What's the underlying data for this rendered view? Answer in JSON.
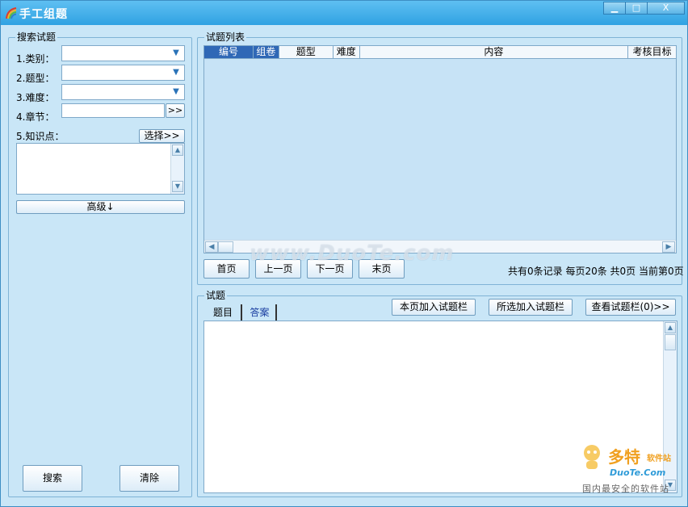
{
  "window": {
    "title": "手工组题",
    "minimize_glyph": "▁",
    "maximize_glyph": "□",
    "close_glyph": "X"
  },
  "search": {
    "group_title": "搜索试题",
    "category_label": "1.类别：",
    "category_value": "",
    "type_label": "2.题型：",
    "type_value": "",
    "difficulty_label": "3.难度：",
    "difficulty_value": "",
    "chapter_label": "4.章节：",
    "chapter_value": "",
    "chapter_button": ">>",
    "knowledge_label": "5.知识点：",
    "select_button": "选择>>",
    "knowledge_value": "",
    "advanced_button": "高级↓",
    "search_button": "搜索",
    "clear_button": "清除"
  },
  "question_list": {
    "group_title": "试题列表",
    "columns": [
      "编号",
      "组卷",
      "题型",
      "难度",
      "内容",
      "考核目标"
    ],
    "selected_columns": [
      "编号",
      "组卷"
    ],
    "rows": [],
    "first_page": "首页",
    "prev_page": "上一页",
    "next_page": "下一页",
    "last_page": "末页",
    "status": "共有0条记录 每页20条 共0页 当前第0页"
  },
  "question": {
    "group_title": "试题",
    "tabs": [
      "题目",
      "答案"
    ],
    "active_tab": "题目",
    "add_page_button": "本页加入试题栏",
    "add_selected_button": "所选加入试题栏",
    "view_basket_button": "查看试题栏(0)>>",
    "body": ""
  },
  "watermark": {
    "text": "www.DuoTe.com",
    "brand": "多特",
    "brand_sub": "软件站",
    "url": "DuoTe.Com",
    "tagline": "国内最安全的软件站"
  },
  "colors": {
    "titlebar": "#2fa2e2",
    "window_bg": "#c9e6f7",
    "grid_bg": "#c7e3f6",
    "selected_header": "#2f68b6",
    "brand_orange": "#f0a020"
  },
  "icons": {
    "app": "rainbow-icon",
    "combo_arrow": "chevron-down-icon",
    "scroll_up": "arrow-up-icon",
    "scroll_down": "arrow-down-icon",
    "scroll_left": "arrow-left-icon",
    "scroll_right": "arrow-right-icon"
  }
}
